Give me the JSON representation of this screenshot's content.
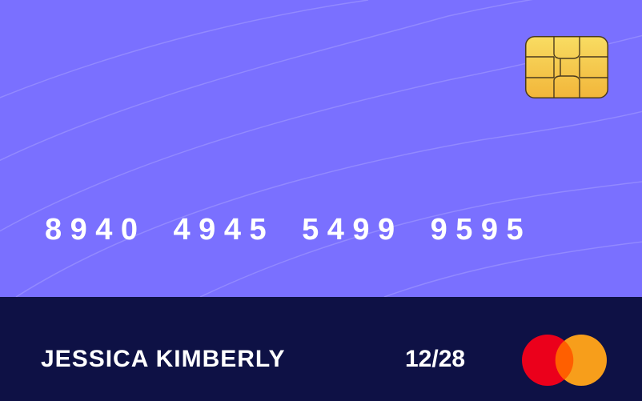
{
  "card": {
    "number_groups": [
      "8940",
      "4945",
      "5499",
      "9595"
    ],
    "holder_name": "JESSICA KIMBERLY",
    "expiry": "12/28",
    "brand_logo_icon": "mastercard-logo-icon",
    "chip_icon": "emv-chip-icon"
  },
  "colors": {
    "card_background": "#7A70FF",
    "footer_background": "#0E1145",
    "text": "#FFFFFF",
    "chip_gold": "#F5C64A",
    "mastercard_red": "#EB001B",
    "mastercard_orange": "#F79E1B",
    "mastercard_overlap": "#FF5F00"
  }
}
